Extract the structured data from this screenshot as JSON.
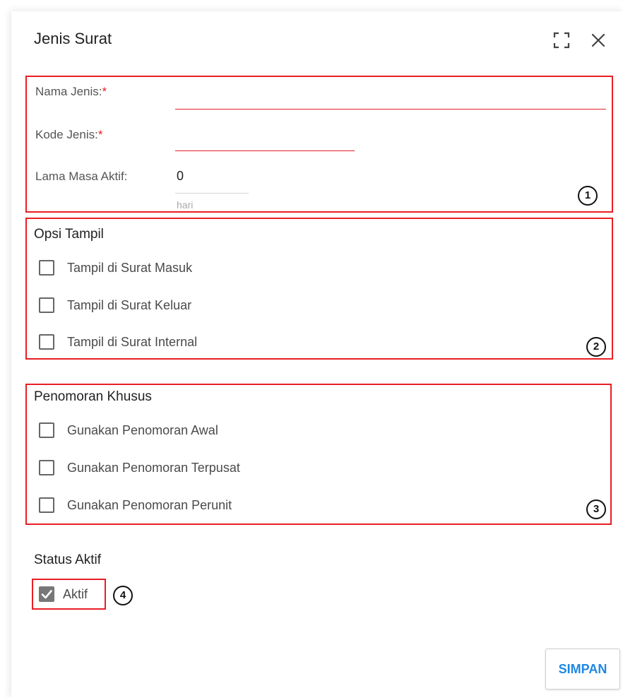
{
  "dialog": {
    "title": "Jenis Surat",
    "icons": {
      "maximize": "fullscreen-icon",
      "close": "close-icon"
    }
  },
  "form": {
    "nama_jenis": {
      "label": "Nama Jenis:",
      "required_mark": "*",
      "value": ""
    },
    "kode_jenis": {
      "label": "Kode Jenis:",
      "required_mark": "*",
      "value": ""
    },
    "lama_masa_aktif": {
      "label": "Lama Masa Aktif:",
      "value": "0",
      "unit": "hari"
    }
  },
  "opsi_tampil": {
    "title": "Opsi Tampil",
    "options": [
      {
        "label": "Tampil di Surat Masuk",
        "checked": false
      },
      {
        "label": "Tampil di Surat Keluar",
        "checked": false
      },
      {
        "label": "Tampil di Surat Internal",
        "checked": false
      }
    ]
  },
  "penomoran_khusus": {
    "title": "Penomoran Khusus",
    "options": [
      {
        "label": "Gunakan Penomoran Awal",
        "checked": false
      },
      {
        "label": "Gunakan Penomoran Terpusat",
        "checked": false
      },
      {
        "label": "Gunakan Penomoran Perunit",
        "checked": false
      }
    ]
  },
  "status_aktif": {
    "title": "Status Aktif",
    "option": {
      "label": "Aktif",
      "checked": true
    }
  },
  "annotations": [
    "1",
    "2",
    "3",
    "4"
  ],
  "actions": {
    "save_label": "SIMPAN"
  },
  "colors": {
    "annotation_border": "#e81e25",
    "required": "#e81e25",
    "primary_text": "#1e88e5"
  }
}
